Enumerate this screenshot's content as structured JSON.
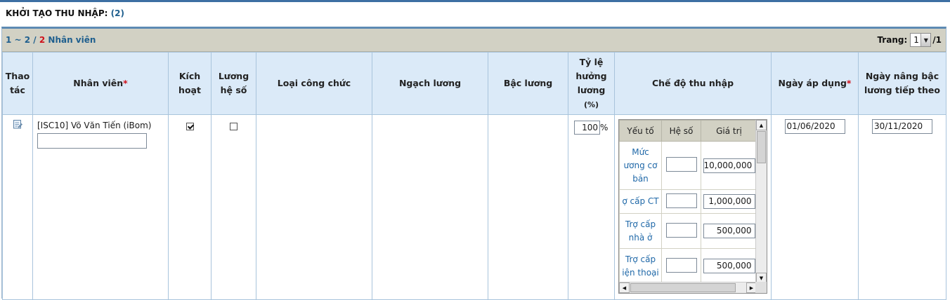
{
  "page": {
    "title": "KHỞI TẠO THU NHẬP:",
    "count": "(2)"
  },
  "pager": {
    "range": "1 ~ 2 /",
    "total": "2",
    "entity": "Nhân viên",
    "page_label": "Trang:",
    "current_page": "1",
    "page_total": "/1"
  },
  "columns": {
    "action_line1": "Thao",
    "action_line2": "tác",
    "employee": "Nhân viên",
    "required_mark": "*",
    "active_line1": "Kích",
    "active_line2": "hoạt",
    "coef_salary_line1": "Lương",
    "coef_salary_line2": "hệ số",
    "civil_type": "Loại công chức",
    "salary_grade": "Ngạch lương",
    "salary_step": "Bậc lương",
    "rate_line1": "Tỷ lệ",
    "rate_line2": "hưởng",
    "rate_line3": "lương",
    "rate_line4": "(%)",
    "income_mode": "Chế độ thu nhập",
    "apply_date": "Ngày áp dụng",
    "next_raise_line1": "Ngày nâng bậc",
    "next_raise_line2": "lương tiếp theo"
  },
  "row": {
    "employee_name": "[ISC10] Võ Văn Tiến (iBom)",
    "employee_input": "",
    "active_checked": true,
    "coef_salary_checked": false,
    "rate_value": "100",
    "rate_unit": "%",
    "apply_date": "01/06/2020",
    "next_raise_date": "30/11/2020"
  },
  "income": {
    "headers": {
      "factor": "Yếu tố",
      "coef": "Hệ số",
      "value": "Giá trị"
    },
    "items": [
      {
        "line1": "Mức",
        "line2": "ương cơ",
        "line3": "bản",
        "coef": "",
        "value": "10,000,000"
      },
      {
        "line1": "ợ cấp CT",
        "line2": "",
        "line3": "",
        "coef": "",
        "value": "1,000,000"
      },
      {
        "line1": "Trợ cấp",
        "line2": "nhà ở",
        "line3": "",
        "coef": "",
        "value": "500,000"
      },
      {
        "line1": "Trợ cấp",
        "line2": "iện thoại",
        "line3": "",
        "coef": "",
        "value": "500,000"
      }
    ]
  },
  "icons": {
    "edit": "edit-record-icon",
    "up": "up-arrow-icon",
    "down": "down-arrow-icon",
    "left": "left-arrow-icon",
    "right": "right-arrow-icon"
  },
  "colors": {
    "header_bg": "#dbeaf8",
    "pager_bg": "#d2d1c4",
    "link": "#1f5f8e",
    "required": "#d0101a"
  }
}
